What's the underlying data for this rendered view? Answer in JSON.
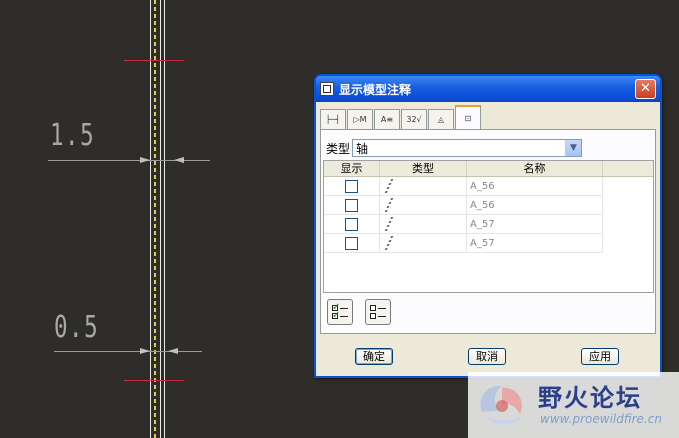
{
  "canvas": {
    "dim_top": "1.5",
    "dim_bottom": "0.5"
  },
  "dialog": {
    "title": "显示模型注释",
    "close_label": "✕",
    "tabs": [
      {
        "icon": "dimension-tab-icon",
        "label": "├─┤"
      },
      {
        "icon": "geometric-tolerance-tab-icon",
        "label": "▷M"
      },
      {
        "icon": "note-tab-icon",
        "label": "A≡"
      },
      {
        "icon": "surface-finish-tab-icon",
        "label": "32√"
      },
      {
        "icon": "symbol-tab-icon",
        "label": "◬"
      },
      {
        "icon": "datum-tab-icon",
        "label": "⊡"
      }
    ],
    "type_label": "类型",
    "type_value": "轴",
    "table": {
      "headers": [
        "显示",
        "类型",
        "名称"
      ],
      "rows": [
        {
          "name": "A_56"
        },
        {
          "name": "A_56"
        },
        {
          "name": "A_57"
        },
        {
          "name": "A_57"
        }
      ]
    },
    "buttons": {
      "ok": "确定",
      "cancel": "取消",
      "apply": "应用"
    }
  },
  "watermark": {
    "title": "野火论坛",
    "url": "www.proewildfire.cn"
  }
}
